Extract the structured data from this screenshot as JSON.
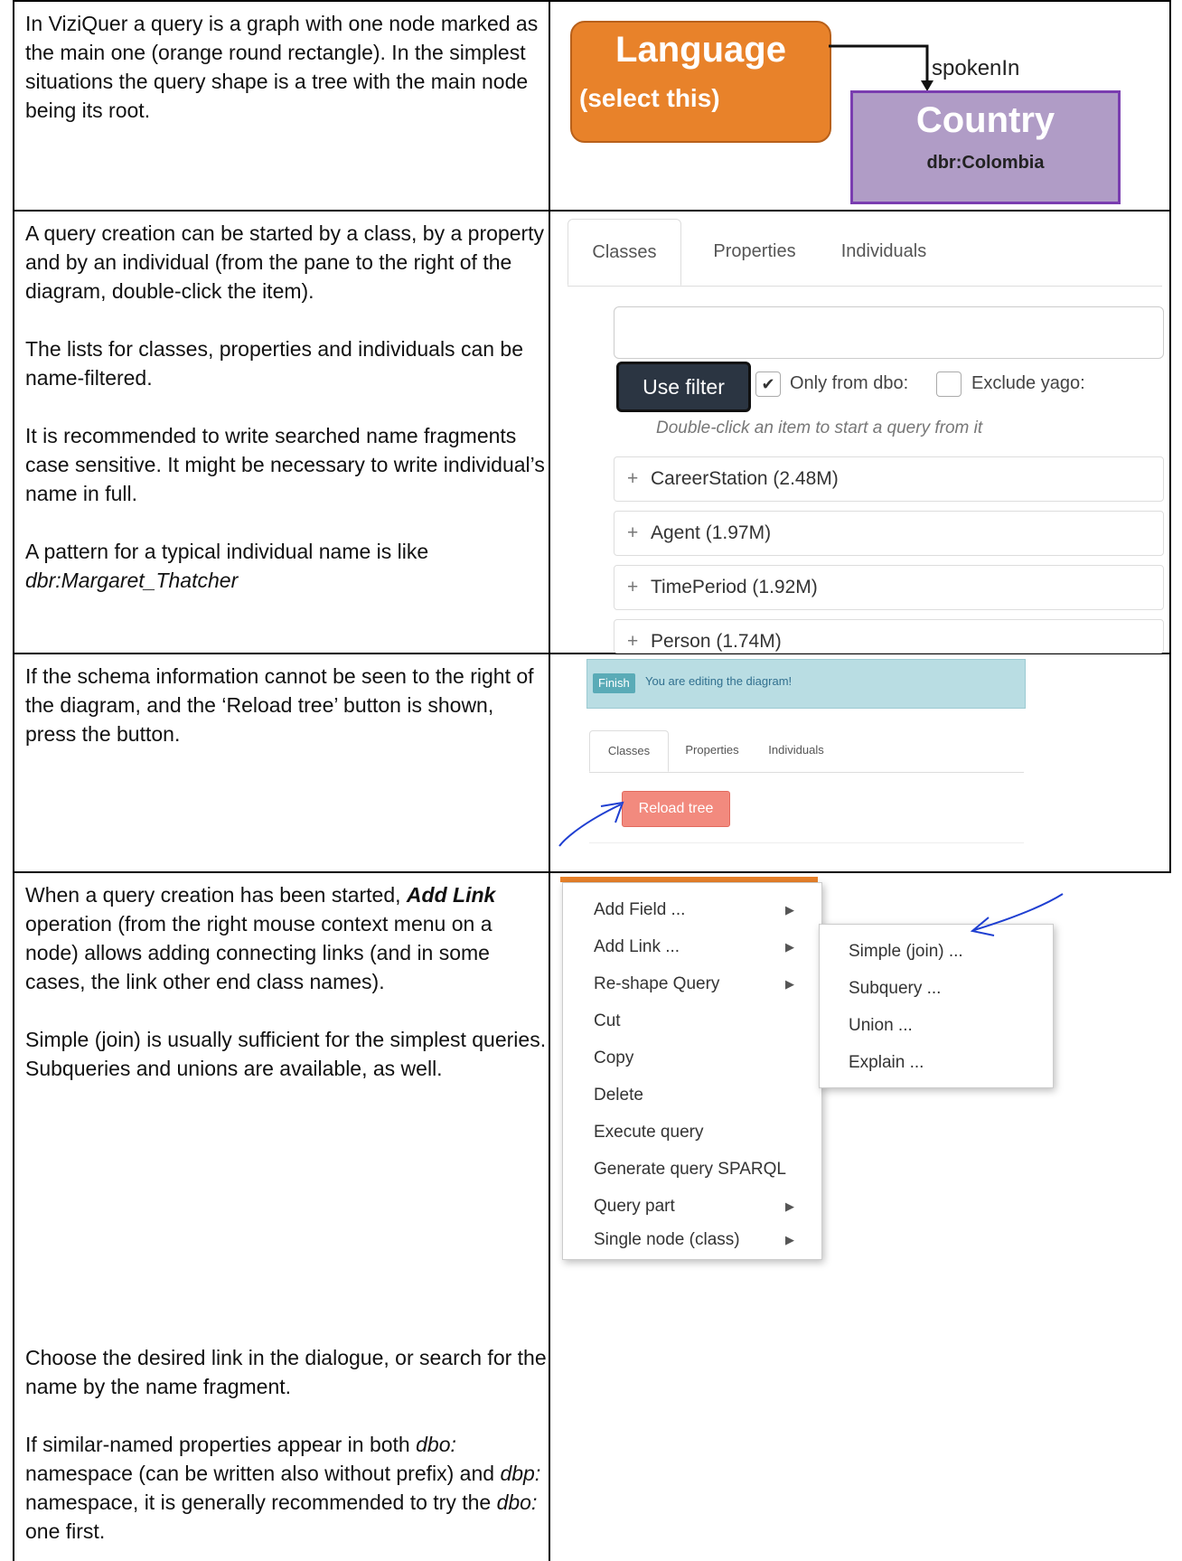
{
  "rows": {
    "r1": {
      "text": "In ViziQuer a query is a graph with one node marked as the main one (orange round rectangle). In the simplest situations the query shape is a tree with the main node being its root.",
      "diagram": {
        "main_node_title": "Language",
        "main_node_sub": "(select this)",
        "link_label": "spokenIn",
        "other_node_title": "Country",
        "other_node_sub": "dbr:Colombia",
        "colors": {
          "main_fill": "#e8822a",
          "other_fill": "#b09cc6",
          "other_border": "#7a3db0"
        }
      }
    },
    "r2": {
      "p1": "A query creation can be started by a class, by a property and by an individual (from the pane to the right of the diagram, double-click the item).",
      "p2": "The lists for classes, properties and individuals can be name-filtered.",
      "p3": "It is recommended to write searched name fragments case sensitive. It might be necessary to write individual’s name in full.",
      "p4": "A pattern for a typical individual name is like",
      "p4_example": "dbr:Margaret_Thatcher",
      "panel": {
        "tabs": [
          "Classes",
          "Properties",
          "Individuals"
        ],
        "filter_value": "",
        "filter_button": "Use filter",
        "check1_label": "Only from dbo:",
        "check1_checked": true,
        "check2_label": "Exclude yago:",
        "check2_checked": false,
        "hint": "Double-click an item to start a query from it",
        "items": [
          "CareerStation (2.48M)",
          "Agent (1.97M)",
          "TimePeriod (1.92M)",
          "Person (1.74M)"
        ]
      }
    },
    "r3": {
      "text": "If the schema information cannot be seen to the right of the diagram, and the ‘Reload tree’ button is shown, press the button.",
      "panel": {
        "finish": "Finish",
        "message": "You are editing the diagram!",
        "tabs": [
          "Classes",
          "Properties",
          "Individuals"
        ],
        "reload": "Reload tree"
      }
    },
    "r4": {
      "p1_start": "When a query creation has been started, ",
      "p1_bold": "Add Link",
      "p1_end": " operation (from the right mouse context menu on a node) allows adding connecting links (and in some cases, the link other end class names).",
      "p2": "Simple (join) is usually sufficient for the simplest queries. Subqueries and unions are available, as well.",
      "p3": "Choose the desired link in the dialogue, or search for the name by the name fragment.",
      "p4_a": "If similar-named properties appear in both ",
      "p4_b": "dbo:",
      "p4_c": " namespace (can be written also without prefix) and ",
      "p4_d": "dbp:",
      "p4_e": " namespace, it is generally recommended to try the ",
      "p4_f": "dbo:",
      "p4_g": " one first.",
      "context_menu": [
        "Add Field ...",
        "Add Link ...",
        "Re-shape Query",
        "Cut",
        "Copy",
        "Delete",
        "Execute query",
        "Generate query SPARQL",
        "Query part",
        "Single node (class)"
      ],
      "submenu": [
        "Simple (join) ...",
        "Subquery ...",
        "Union ...",
        "Explain ..."
      ],
      "arrow_glyph": "▶"
    }
  }
}
